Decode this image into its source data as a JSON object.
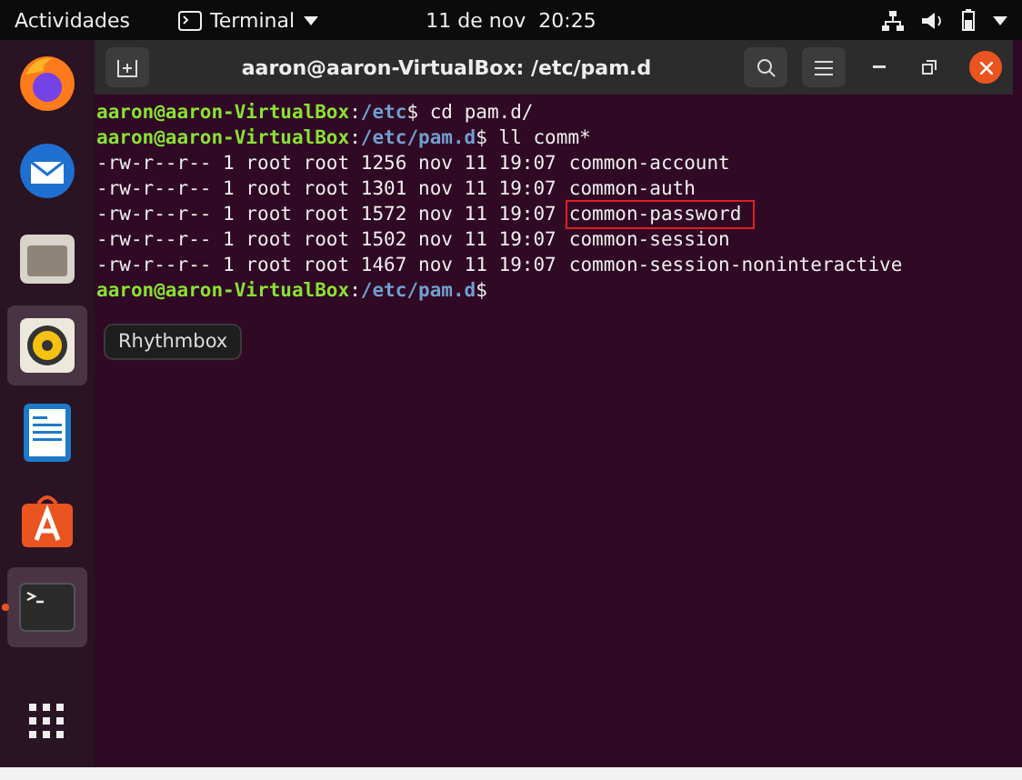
{
  "top_bar": {
    "activities": "Actividades",
    "app_menu": "Terminal",
    "clock": "11 de nov  20:25"
  },
  "dock": {
    "items": [
      {
        "kind": "browser",
        "highlighted": false,
        "running": false
      },
      {
        "kind": "mail",
        "highlighted": false,
        "running": false
      },
      {
        "kind": "files",
        "highlighted": false,
        "running": false
      },
      {
        "kind": "music",
        "highlighted": true,
        "running": false
      },
      {
        "kind": "document",
        "highlighted": false,
        "running": false
      },
      {
        "kind": "store",
        "highlighted": false,
        "running": false
      },
      {
        "kind": "terminal",
        "highlighted": true,
        "running": true
      }
    ],
    "tooltip": "Rhythmbox"
  },
  "window": {
    "title": "aaron@aaron-VirtualBox: /etc/pam.d"
  },
  "terminal": {
    "lines": [
      {
        "kind": "prompt",
        "user": "aaron@aaron-VirtualBox",
        "separator": ":",
        "path": "/etc",
        "prompt_sign": "$",
        "command": "cd pam.d/"
      },
      {
        "kind": "prompt",
        "user": "aaron@aaron-VirtualBox",
        "separator": ":",
        "path": "/etc/pam.d",
        "prompt_sign": "$",
        "command": "ll comm*"
      },
      {
        "kind": "output",
        "info": "-rw-r--r-- 1 root root 1256 nov 11 19:07",
        "file": "common-account",
        "highlighted": false
      },
      {
        "kind": "output",
        "info": "-rw-r--r-- 1 root root 1301 nov 11 19:07",
        "file": "common-auth",
        "highlighted": false
      },
      {
        "kind": "output",
        "info": "-rw-r--r-- 1 root root 1572 nov 11 19:07",
        "file": "common-password",
        "highlighted": true
      },
      {
        "kind": "output",
        "info": "-rw-r--r-- 1 root root 1502 nov 11 19:07",
        "file": "common-session",
        "highlighted": false
      },
      {
        "kind": "output",
        "info": "-rw-r--r-- 1 root root 1467 nov 11 19:07",
        "file": "common-session-noninteractive",
        "highlighted": false
      },
      {
        "kind": "prompt",
        "user": "aaron@aaron-VirtualBox",
        "separator": ":",
        "path": "/etc/pam.d",
        "prompt_sign": "$"
      }
    ]
  }
}
